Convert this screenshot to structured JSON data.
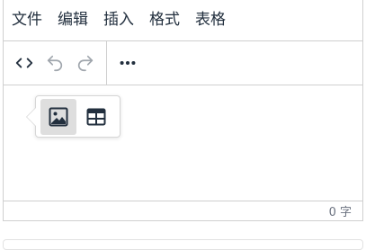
{
  "menubar": {
    "items": [
      "文件",
      "编辑",
      "插入",
      "格式",
      "表格"
    ]
  },
  "toolbar": {
    "icons": [
      "source-code-icon",
      "undo-icon",
      "redo-icon",
      "more-icon"
    ]
  },
  "popup": {
    "buttons": [
      "image-icon",
      "table-icon"
    ],
    "active": "image-icon"
  },
  "statusbar": {
    "word_count": "0 字"
  },
  "colors": {
    "text": "#222f3e",
    "disabled": "#a0a6ad",
    "border": "#cfcfcf",
    "active_bg": "#dedede"
  }
}
